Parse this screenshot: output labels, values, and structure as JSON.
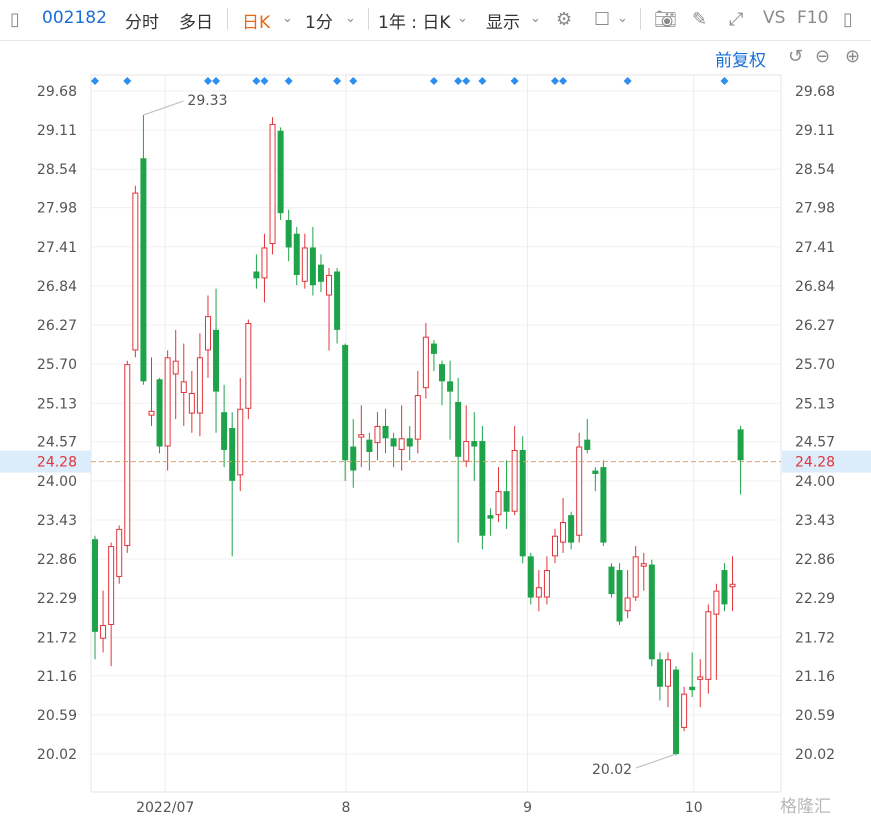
{
  "toolbar": {
    "stock_code": "002182",
    "tab_intraday": "分时",
    "tab_multiday": "多日",
    "tab_daily": "日K",
    "tab_1min": "1分",
    "range": "1年 : 日K",
    "display": "显示",
    "vs": "VS",
    "f10": "F10"
  },
  "adjust_label": "前复权",
  "watermark": "格隆汇",
  "colors": {
    "up": "#e0353b",
    "down": "#1ea34a",
    "accent": "#1a6fd6",
    "marker": "#2b8ef0",
    "refline": "#d9a06a"
  },
  "chart_data": {
    "type": "candlestick",
    "ylim": [
      19.6,
      29.9
    ],
    "y_ticks": [
      "29.68",
      "29.11",
      "28.54",
      "27.98",
      "27.41",
      "26.84",
      "26.27",
      "25.70",
      "25.13",
      "24.57",
      "24.00",
      "23.43",
      "22.86",
      "22.29",
      "21.72",
      "21.16",
      "20.59",
      "20.02"
    ],
    "x_labels": [
      {
        "label": "2022/07",
        "index": 8.7
      },
      {
        "label": "8",
        "index": 31.1
      },
      {
        "label": "9",
        "index": 53.6
      },
      {
        "label": "10",
        "index": 74.2
      }
    ],
    "reference_price": "24.28",
    "high_annotation": {
      "label": "29.33",
      "index": 6,
      "value": 29.33
    },
    "low_annotation": {
      "label": "20.02",
      "index": 72,
      "value": 20.02
    },
    "event_markers": [
      0,
      4,
      14,
      15,
      20,
      21,
      24,
      30,
      32,
      42,
      45,
      46,
      48,
      52,
      57,
      58,
      66,
      78
    ],
    "candles": [
      [
        23.15,
        21.8,
        23.2,
        21.4
      ],
      [
        21.7,
        21.9,
        22.4,
        21.5
      ],
      [
        21.9,
        23.05,
        23.1,
        21.3
      ],
      [
        22.6,
        23.3,
        23.35,
        22.5
      ],
      [
        23.05,
        25.7,
        25.75,
        22.95
      ],
      [
        25.9,
        28.2,
        28.3,
        25.8
      ],
      [
        28.7,
        25.45,
        29.33,
        25.4
      ],
      [
        24.95,
        25.02,
        25.8,
        24.8
      ],
      [
        25.48,
        24.5,
        25.5,
        24.4
      ],
      [
        24.5,
        25.8,
        25.9,
        24.15
      ],
      [
        25.55,
        25.75,
        26.2,
        24.9
      ],
      [
        25.28,
        25.45,
        26.0,
        24.8
      ],
      [
        24.98,
        25.28,
        25.6,
        24.7
      ],
      [
        24.98,
        25.8,
        26.15,
        24.65
      ],
      [
        25.9,
        26.4,
        26.7,
        25.5
      ],
      [
        26.2,
        25.3,
        26.8,
        24.7
      ],
      [
        25.0,
        24.45,
        25.4,
        24.2
      ],
      [
        24.77,
        24.0,
        25.0,
        22.9
      ],
      [
        24.08,
        25.05,
        25.5,
        23.85
      ],
      [
        25.05,
        26.3,
        26.35,
        24.9
      ],
      [
        27.05,
        26.95,
        27.3,
        26.8
      ],
      [
        26.95,
        27.4,
        27.6,
        26.6
      ],
      [
        27.45,
        29.2,
        29.3,
        27.3
      ],
      [
        29.1,
        27.9,
        29.15,
        27.8
      ],
      [
        27.8,
        27.4,
        27.95,
        27.2
      ],
      [
        27.6,
        27.0,
        27.7,
        26.85
      ],
      [
        26.9,
        27.4,
        27.6,
        26.8
      ],
      [
        27.4,
        26.85,
        27.7,
        26.7
      ],
      [
        27.15,
        26.9,
        27.3,
        26.75
      ],
      [
        26.7,
        27.0,
        27.1,
        25.9
      ],
      [
        27.05,
        26.2,
        27.1,
        26.0
      ],
      [
        25.98,
        24.3,
        26.0,
        24.0
      ],
      [
        24.5,
        24.15,
        24.9,
        23.9
      ],
      [
        24.63,
        24.68,
        25.1,
        24.2
      ],
      [
        24.6,
        24.42,
        24.7,
        24.15
      ],
      [
        24.55,
        24.8,
        25.0,
        24.3
      ],
      [
        24.8,
        24.62,
        25.05,
        24.4
      ],
      [
        24.62,
        24.5,
        24.7,
        24.2
      ],
      [
        24.45,
        24.62,
        25.1,
        24.15
      ],
      [
        24.62,
        24.5,
        24.8,
        24.3
      ],
      [
        24.6,
        25.25,
        25.6,
        24.4
      ],
      [
        25.35,
        26.1,
        26.3,
        25.2
      ],
      [
        26.0,
        25.85,
        26.05,
        25.6
      ],
      [
        25.7,
        25.45,
        25.75,
        25.1
      ],
      [
        25.45,
        25.3,
        25.75,
        24.6
      ],
      [
        25.15,
        24.35,
        25.5,
        23.1
      ],
      [
        24.28,
        24.58,
        25.1,
        24.2
      ],
      [
        24.58,
        24.5,
        25.0,
        24.0
      ],
      [
        24.58,
        23.2,
        24.8,
        23.0
      ],
      [
        23.5,
        23.45,
        23.6,
        23.2
      ],
      [
        23.5,
        23.85,
        24.2,
        23.4
      ],
      [
        23.85,
        23.55,
        24.3,
        23.3
      ],
      [
        23.55,
        24.45,
        24.8,
        23.5
      ],
      [
        24.45,
        22.9,
        24.65,
        22.8
      ],
      [
        22.9,
        22.3,
        22.95,
        22.2
      ],
      [
        22.3,
        22.45,
        22.7,
        22.1
      ],
      [
        22.3,
        22.7,
        22.9,
        22.2
      ],
      [
        22.9,
        23.2,
        23.3,
        22.8
      ],
      [
        23.1,
        23.4,
        23.75,
        22.95
      ],
      [
        23.5,
        23.1,
        23.55,
        23.0
      ],
      [
        23.2,
        24.5,
        24.7,
        23.1
      ],
      [
        24.6,
        24.45,
        24.9,
        24.4
      ],
      [
        24.15,
        24.1,
        24.2,
        23.85
      ],
      [
        24.2,
        23.1,
        24.3,
        23.05
      ],
      [
        22.75,
        22.35,
        22.8,
        22.3
      ],
      [
        22.7,
        21.95,
        22.8,
        21.9
      ],
      [
        22.1,
        22.3,
        22.7,
        22.0
      ],
      [
        22.3,
        22.9,
        23.05,
        22.25
      ],
      [
        22.75,
        22.8,
        22.95,
        22.4
      ],
      [
        22.78,
        21.4,
        22.85,
        21.3
      ],
      [
        21.4,
        21.0,
        21.5,
        20.8
      ],
      [
        21.0,
        21.4,
        21.5,
        20.7
      ],
      [
        21.25,
        20.02,
        21.3,
        20.0
      ],
      [
        20.4,
        20.9,
        21.0,
        20.35
      ],
      [
        21.0,
        20.95,
        21.5,
        20.85
      ],
      [
        21.1,
        21.15,
        21.4,
        20.7
      ],
      [
        21.1,
        22.1,
        22.2,
        20.9
      ],
      [
        22.05,
        22.4,
        22.5,
        21.1
      ],
      [
        22.7,
        22.2,
        22.8,
        22.1
      ],
      [
        22.45,
        22.5,
        22.9,
        22.1
      ],
      [
        24.75,
        24.3,
        24.8,
        23.8
      ]
    ]
  }
}
